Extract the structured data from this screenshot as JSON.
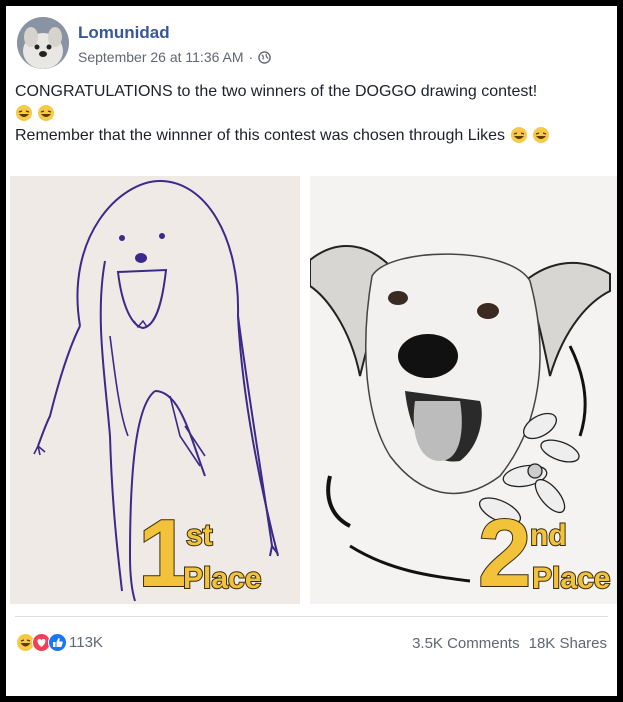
{
  "post": {
    "author": "Lomunidad",
    "timestamp": "September 26 at 11:36 AM",
    "meta_separator": "·",
    "line1": "CONGRATULATIONS to the two winners of the DOGGO drawing contest!",
    "line2": "Remember that the winnner of this contest was chosen through Likes"
  },
  "photos": [
    {
      "place_number": "1",
      "place_suffix": "st",
      "place_word": "Place"
    },
    {
      "place_number": "2",
      "place_suffix": "nd",
      "place_word": "Place"
    }
  ],
  "footer": {
    "reaction_count": "113K",
    "comments": "3.5K Comments",
    "shares": "18K Shares"
  },
  "icons": {
    "audience": "globe-icon",
    "reactions": [
      "haha-reaction-icon",
      "love-reaction-icon",
      "like-reaction-icon"
    ]
  },
  "colors": {
    "author_link": "#365899",
    "meta_text": "#616770",
    "place_badge": "#f2c23a",
    "love": "#f33e58",
    "like": "#1877f2"
  }
}
